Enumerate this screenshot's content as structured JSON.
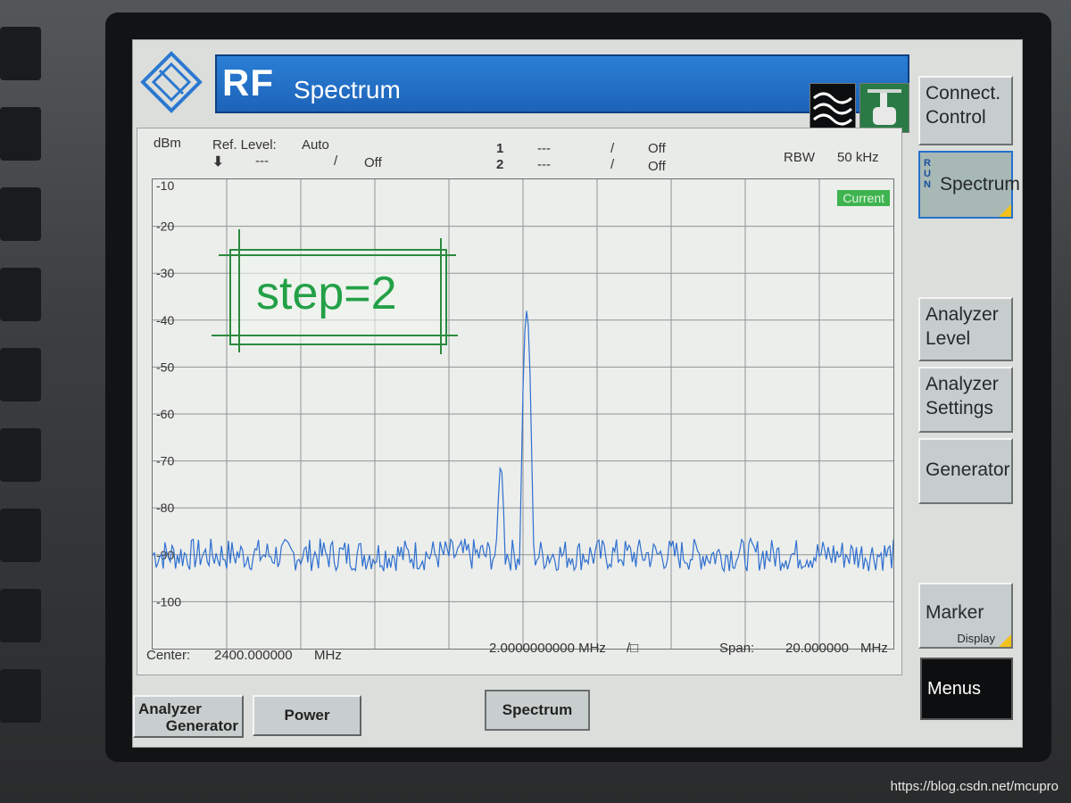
{
  "app": {
    "title_rf": "RF",
    "title_name": "Spectrum"
  },
  "header": {
    "unit": "dBm",
    "ref_level_label": "Ref. Level:",
    "ref_level_value": "Auto",
    "r_dashes": "---",
    "r_sep": "/",
    "r_state": "Off",
    "marker1_id": "1",
    "marker1_dashes": "---",
    "marker1_sep": "/",
    "marker1_state": "Off",
    "marker2_id": "2",
    "marker2_dashes": "---",
    "marker2_sep": "/",
    "marker2_state": "Off",
    "rbw_label": "RBW",
    "rbw_value": "50 kHz"
  },
  "chart_data": {
    "type": "line",
    "y_tick_labels": [
      "-10",
      "-20",
      "-30",
      "-40",
      "-50",
      "-60",
      "-70",
      "-80",
      "-90",
      "-100"
    ],
    "ylim": [
      -110,
      -10
    ],
    "xlim_mhz": [
      2390,
      2410
    ],
    "x_divisions": 10,
    "grid": true,
    "trace_color": "#2f6fd0",
    "series": [
      {
        "noise_floor_dbm": -90,
        "peaks": [
          {
            "x_mhz": 2400.1,
            "y_dbm": -38
          },
          {
            "x_mhz": 2399.4,
            "y_dbm": -71
          }
        ]
      }
    ]
  },
  "trace_badge": "Current",
  "footer": {
    "center_label": "Center:",
    "center_value": "2400.000000",
    "center_unit": "MHz",
    "div_value": "2.0000000000 MHz",
    "div_suffix": "/□",
    "span_label": "Span:",
    "span_value": "20.000000",
    "span_unit": "MHz"
  },
  "annotation": {
    "text": "step=2",
    "color": "#22a046"
  },
  "softkeys": {
    "connect_control": [
      "Connect.",
      "Control"
    ],
    "spectrum": "Spectrum",
    "run_tag": [
      "R",
      "U",
      "N"
    ],
    "analyzer_level": [
      "Analyzer",
      "Level"
    ],
    "analyzer_settings": [
      "Analyzer",
      "Settings"
    ],
    "generator": "Generator",
    "marker": "Marker",
    "marker_sub": "Display",
    "menus": "Menus"
  },
  "tabs": {
    "analyzer_generator": [
      "Analyzer",
      "Generator"
    ],
    "power": "Power",
    "spectrum": "Spectrum"
  },
  "watermark": "https://blog.csdn.net/mcupro",
  "colors": {
    "titlebar": "#1d63b8",
    "accent_green": "#3fb34f",
    "corner_yellow": "#f2c21b"
  }
}
